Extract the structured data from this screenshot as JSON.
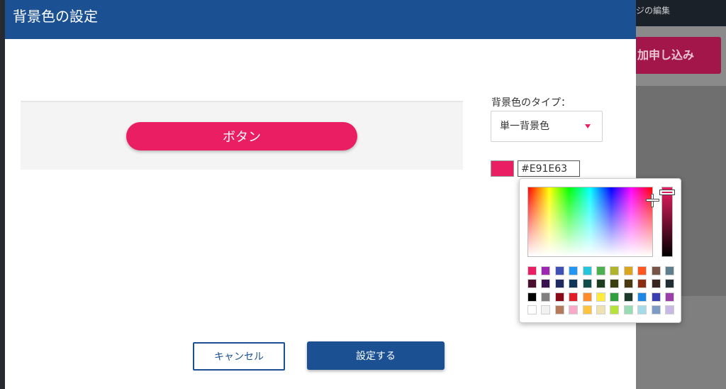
{
  "background_app": {
    "tab_fragment": "ジの編集",
    "apply_button_fragment": "加申し込み",
    "colors": {
      "apply_bg": "#a3164a"
    }
  },
  "dialog": {
    "title": "背景色の設定",
    "preview_button_label": "ボタン",
    "type_label": "背景色のタイプ：",
    "type_select_value": "単一背景色",
    "hex_value": "#E91E63",
    "cancel_label": "キャンセル",
    "ok_label": "設定する",
    "colors": {
      "header": "#1b5193",
      "accent": "#e91e63"
    }
  },
  "picker": {
    "current_color": "#e91e63",
    "palette": [
      [
        "#e91e63",
        "#9c27b0",
        "#3f51b5",
        "#2196f3",
        "#26c6da",
        "#4caf50",
        "#afb42b",
        "#daa520",
        "#ff5722",
        "#795548",
        "#607d8b"
      ],
      [
        "#4a0f2e",
        "#38124f",
        "#1f2a5e",
        "#0f3657",
        "#0f4e4a",
        "#1c3d1f",
        "#3b3f0f",
        "#4a3810",
        "#8b2d12",
        "#3a2420",
        "#222d33"
      ],
      [
        "#000000",
        "#808080",
        "#8b0a1a",
        "#e11d2a",
        "#ff8c2a",
        "#ffeb3b",
        "#2e9e3e",
        "#1b3a2a",
        "#1e88e5",
        "#3b3db0",
        "#9b3fa8"
      ],
      [
        "#ffffff",
        "#f2f2f2",
        "#b57a5a",
        "#f8a8c8",
        "#ffc43d",
        "#efe2b2",
        "#b6e23a",
        "#98dcb4",
        "#a6dbe8",
        "#7c9cc6",
        "#c8b8e6"
      ]
    ]
  }
}
